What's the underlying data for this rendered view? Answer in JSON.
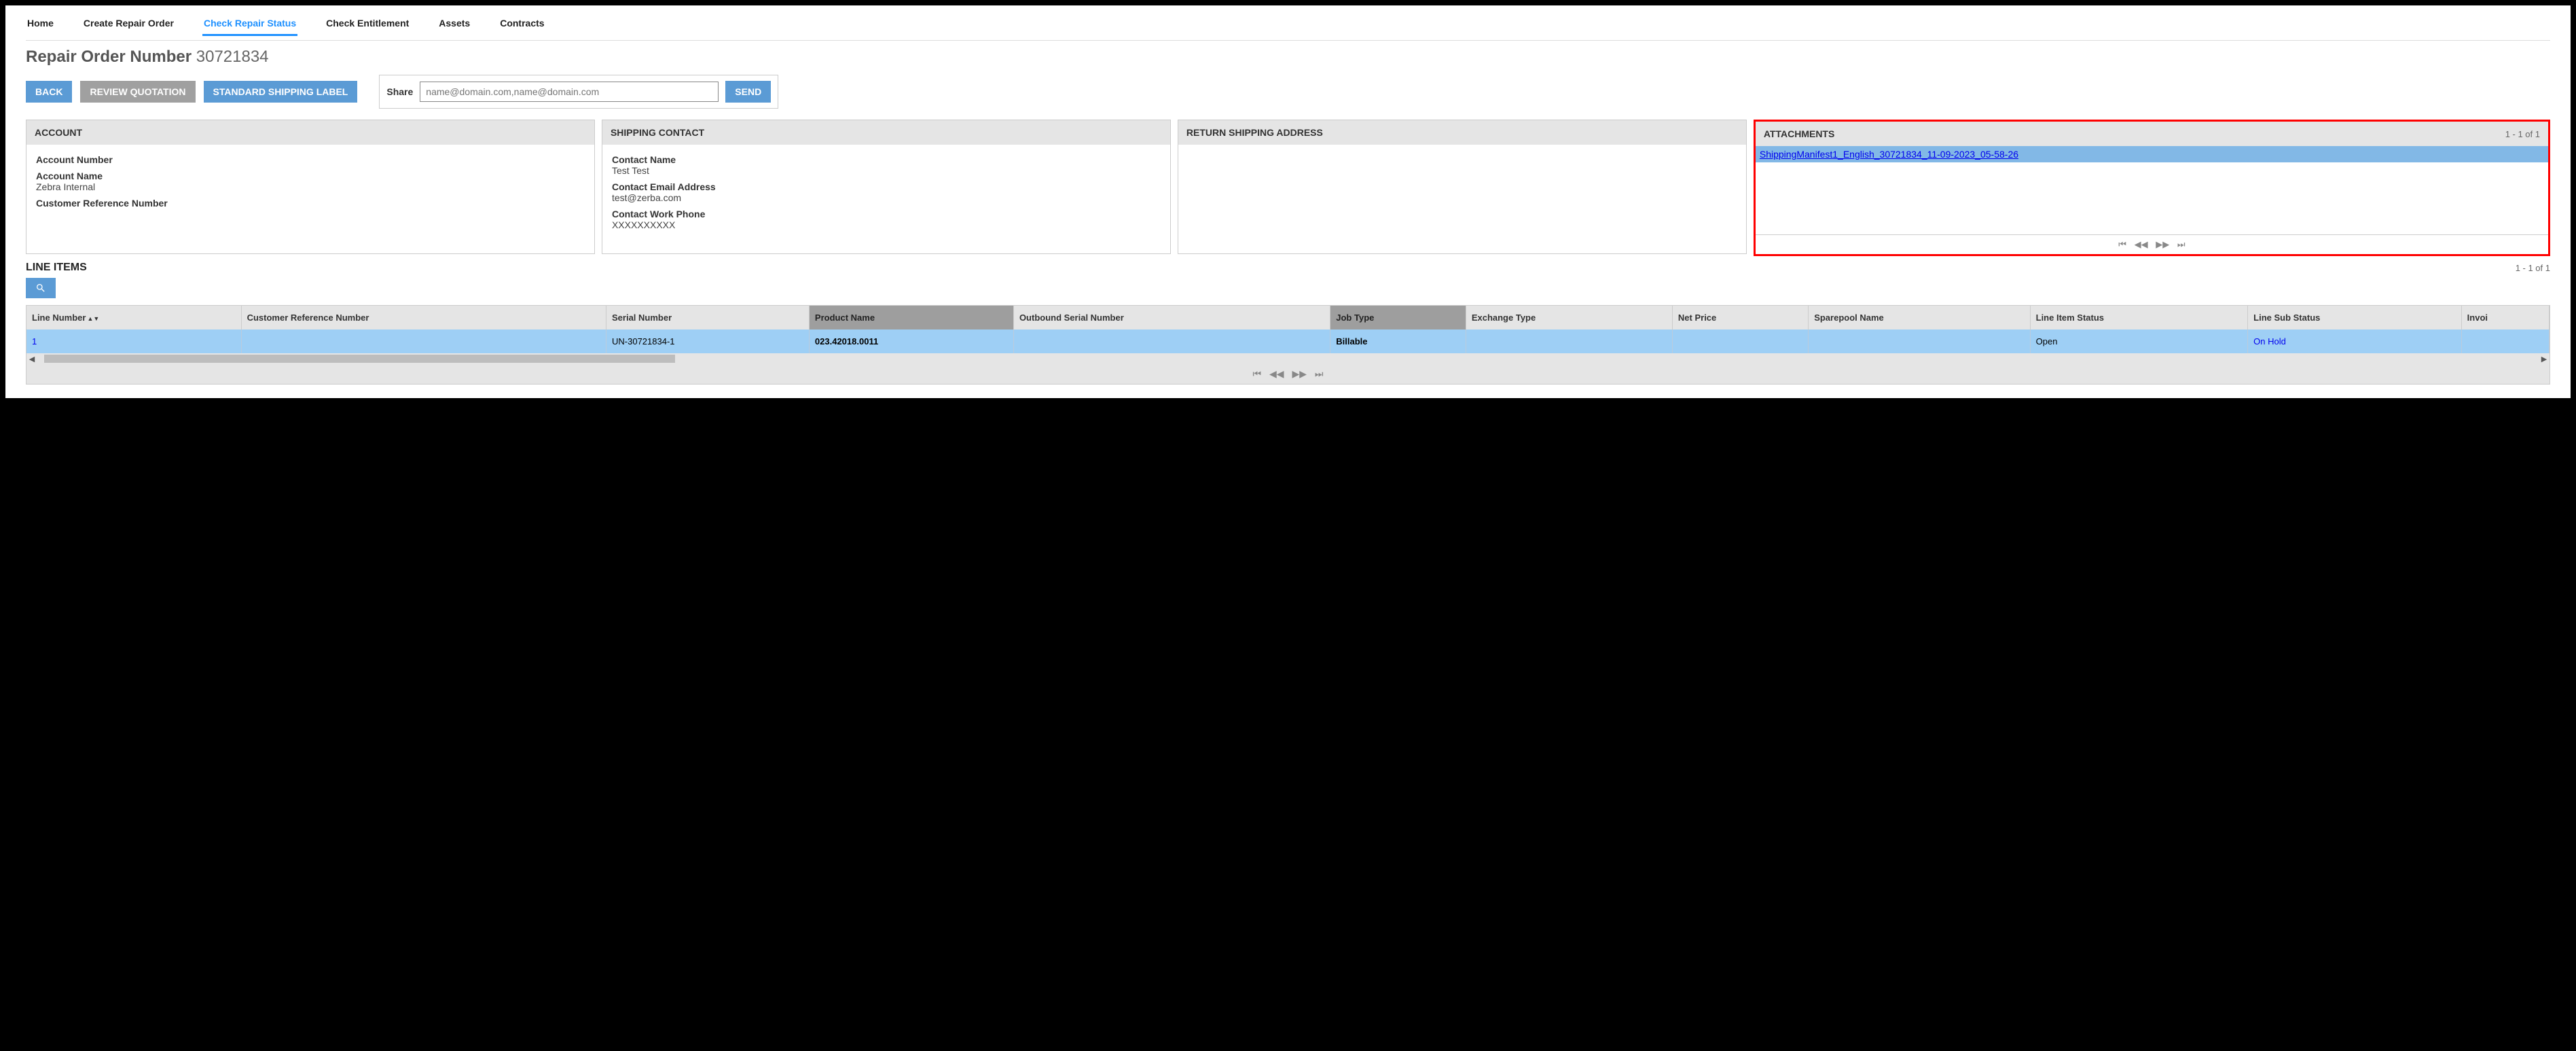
{
  "nav": {
    "items": [
      {
        "label": "Home",
        "active": false
      },
      {
        "label": "Create Repair Order",
        "active": false
      },
      {
        "label": "Check Repair Status",
        "active": true
      },
      {
        "label": "Check Entitlement",
        "active": false
      },
      {
        "label": "Assets",
        "active": false
      },
      {
        "label": "Contracts",
        "active": false
      }
    ]
  },
  "page": {
    "title_prefix": "Repair Order Number",
    "order_number": "30721834"
  },
  "actions": {
    "back": "BACK",
    "review_quotation": "REVIEW QUOTATION",
    "standard_shipping_label": "STANDARD SHIPPING LABEL"
  },
  "share": {
    "label": "Share",
    "placeholder": "name@domain.com,name@domain.com",
    "send": "SEND"
  },
  "account": {
    "header": "ACCOUNT",
    "number_label": "Account Number",
    "number_value": "",
    "name_label": "Account Name",
    "name_value": "Zebra Internal",
    "crn_label": "Customer Reference Number",
    "crn_value": ""
  },
  "shipping_contact": {
    "header": "SHIPPING CONTACT",
    "name_label": "Contact Name",
    "name_value": "Test Test",
    "email_label": "Contact Email Address",
    "email_value": "test@zerba.com",
    "phone_label": "Contact Work Phone",
    "phone_value": "XXXXXXXXXX"
  },
  "return_address": {
    "header": "RETURN SHIPPING ADDRESS"
  },
  "attachments": {
    "header": "ATTACHMENTS",
    "pager": "1 - 1 of 1",
    "items": [
      "ShippingManifest1_English_30721834_11-09-2023_05-58-26"
    ]
  },
  "line_items": {
    "title": "LINE ITEMS",
    "pager": "1 - 1 of 1",
    "columns": [
      {
        "label": "Line Number",
        "sorted": true
      },
      {
        "label": "Customer Reference Number"
      },
      {
        "label": "Serial Number"
      },
      {
        "label": "Product Name",
        "emph": true
      },
      {
        "label": "Outbound Serial Number"
      },
      {
        "label": "Job Type",
        "emph": true
      },
      {
        "label": "Exchange Type"
      },
      {
        "label": "Net Price"
      },
      {
        "label": "Sparepool Name"
      },
      {
        "label": "Line Item Status"
      },
      {
        "label": "Line Sub Status"
      },
      {
        "label": "Invoi"
      }
    ],
    "rows": [
      {
        "line_number": "1",
        "crn": "",
        "serial": "UN-30721834-1",
        "product_name": "023.42018.0011",
        "outbound_serial": "",
        "job_type": "Billable",
        "exchange_type": "",
        "net_price": "",
        "sparepool": "",
        "status": "Open",
        "sub_status": "On Hold",
        "invoice": ""
      }
    ]
  }
}
